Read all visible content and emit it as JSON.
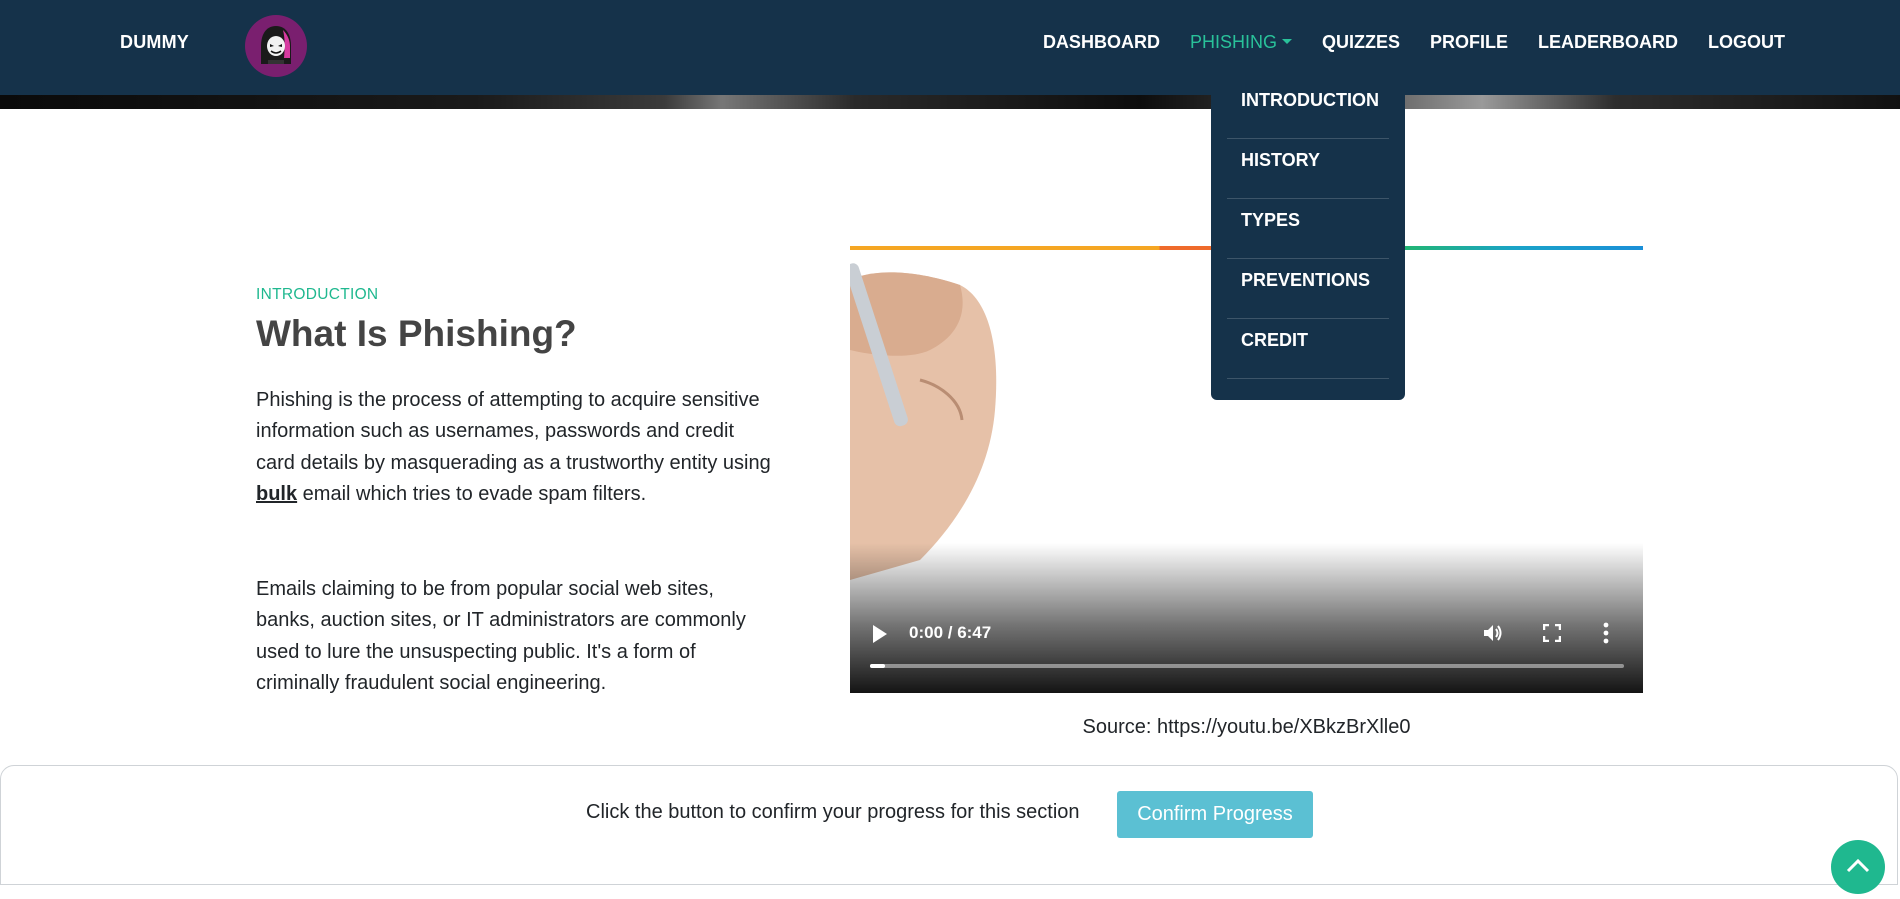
{
  "nav": {
    "brand": "DUMMY",
    "links": {
      "dashboard": "DASHBOARD",
      "phishing": "PHISHING",
      "quizzes": "QUIZZES",
      "profile": "PROFILE",
      "leaderboard": "LEADERBOARD",
      "logout": "LOGOUT"
    },
    "dropdown": [
      "INTRODUCTION",
      "HISTORY",
      "TYPES",
      "PREVENTIONS",
      "CREDIT"
    ]
  },
  "main": {
    "eyebrow": "INTRODUCTION",
    "title": "What Is Phishing?",
    "para1_before": "Phishing is the process of attempting to acquire sensitive information such as usernames, passwords and credit card details by masquerading as a trustworthy entity using ",
    "para1_link": "bulk",
    "para1_after": " email which tries to evade spam filters.",
    "para2": "Emails claiming to be from popular social web sites, banks, auction sites, or IT administrators are commonly used to lure the unsuspecting public. It's a form of criminally fraudulent social engineering."
  },
  "video": {
    "time": "0:00 / 6:47",
    "progress": 0.02,
    "source": "Source: https://youtu.be/XBkzBrXlle0"
  },
  "progress_bar": {
    "text": "Click the button to confirm your progress for this section",
    "button": "Confirm Progress"
  },
  "colors": {
    "navbar": "#15324a",
    "accent": "#29c29a",
    "button": "#5bc0d3",
    "logo_bg": "#7a1f6f"
  },
  "icons": {
    "logo": "hooded-hacker-icon",
    "play": "play-icon",
    "volume": "volume-icon",
    "fullscreen": "fullscreen-icon",
    "more": "more-vertical-icon",
    "scroll_top": "chevron-up-icon"
  }
}
